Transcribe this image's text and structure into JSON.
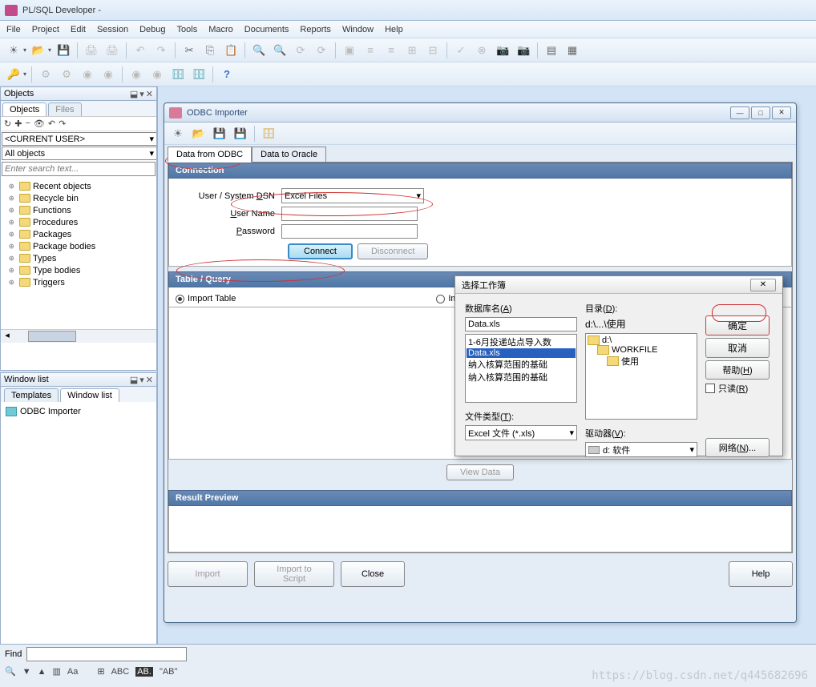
{
  "app": {
    "title": "PL/SQL Developer -"
  },
  "menu": {
    "items": [
      "File",
      "Project",
      "Edit",
      "Session",
      "Debug",
      "Tools",
      "Macro",
      "Documents",
      "Reports",
      "Window",
      "Help"
    ]
  },
  "objects": {
    "panel_title": "Objects",
    "tabs": {
      "objects": "Objects",
      "files": "Files"
    },
    "user_dropdown": "<CURRENT USER>",
    "filter_dropdown": "All objects",
    "search_placeholder": "Enter search text...",
    "tree": [
      "Recent objects",
      "Recycle bin",
      "Functions",
      "Procedures",
      "Packages",
      "Package bodies",
      "Types",
      "Type bodies",
      "Triggers"
    ]
  },
  "windowlist": {
    "panel_title": "Window list",
    "tabs": {
      "templates": "Templates",
      "windowlist": "Window list"
    },
    "items": [
      "ODBC Importer"
    ]
  },
  "odbc": {
    "title": "ODBC Importer",
    "tabs": {
      "from": "Data from ODBC",
      "to": "Data to Oracle"
    },
    "connection": {
      "header": "Connection",
      "dsn_label_pre": "User / System ",
      "dsn_label_u": "D",
      "dsn_label_post": "SN",
      "dsn_value": "Excel Files",
      "user_label": "User Name",
      "user_label_u": "U",
      "user_label_rest": "ser Name",
      "pass_label_u": "P",
      "pass_label_rest": "assword",
      "connect": "Connect",
      "disconnect": "Disconnect"
    },
    "tablequery": {
      "header": "Table / Query",
      "import_table": "Import Table",
      "import_query": "Import Q",
      "view_data": "View Data"
    },
    "result": {
      "header": "Result Preview"
    },
    "buttons": {
      "import": "Import",
      "script": "Import to Script",
      "close": "Close",
      "help": "Help"
    }
  },
  "workbook": {
    "title": "选择工作簿",
    "db_label": "数据库名(",
    "db_label_u": "A",
    "db_label_post": ")",
    "db_value": "Data.xls",
    "db_list": [
      "1-6月投递站点导入数",
      "Data.xls",
      "纳入核算范围的基础",
      "纳入核算范围的基础"
    ],
    "db_selected_index": 1,
    "filetype_label": "文件类型(",
    "filetype_label_u": "T",
    "filetype_label_post": "):",
    "filetype_value": "Excel 文件 (*.xls)",
    "dir_label": "目录(",
    "dir_label_u": "D",
    "dir_label_post": "):",
    "dir_path": "d:\\...\\使用",
    "dir_tree": [
      "d:\\",
      "WORKFILE",
      "使用"
    ],
    "drive_label": "驱动器(",
    "drive_label_u": "V",
    "drive_label_post": "):",
    "drive_value": "d: 软件",
    "ok": "确定",
    "cancel": "取消",
    "help": "帮助(",
    "help_u": "H",
    "help_post": ")",
    "readonly": "只读(",
    "readonly_u": "R",
    "readonly_post": ")",
    "network": "网络(",
    "network_u": "N",
    "network_post": ")..."
  },
  "find": {
    "label": "Find",
    "ab_literal": "\"AB\""
  },
  "watermark": "https://blog.csdn.net/q445682696"
}
